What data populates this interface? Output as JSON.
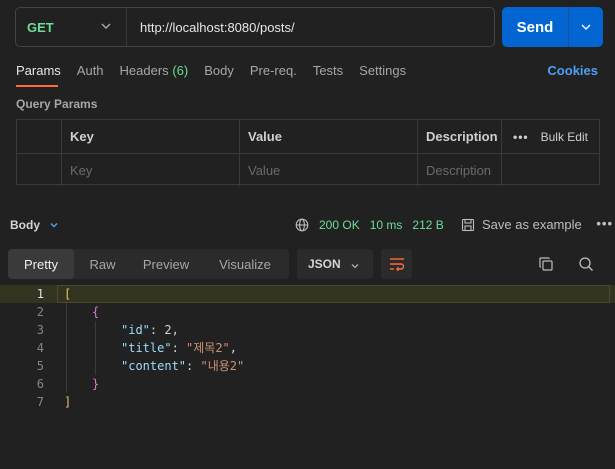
{
  "request": {
    "method": "GET",
    "url": "http://localhost:8080/posts/",
    "send_label": "Send"
  },
  "tabs": [
    {
      "label": "Params"
    },
    {
      "label": "Auth"
    },
    {
      "label": "Headers",
      "count": "(6)"
    },
    {
      "label": "Body"
    },
    {
      "label": "Pre-req."
    },
    {
      "label": "Tests"
    },
    {
      "label": "Settings"
    }
  ],
  "cookies_label": "Cookies",
  "query_params": {
    "title": "Query Params",
    "headers": {
      "key": "Key",
      "value": "Value",
      "description": "Description",
      "bulk_edit": "Bulk Edit",
      "more": "•••"
    },
    "placeholders": {
      "key": "Key",
      "value": "Value",
      "description": "Description"
    }
  },
  "response": {
    "body_label": "Body",
    "status": "200 OK",
    "time": "10 ms",
    "size": "212 B",
    "save_label": "Save as example",
    "more": "•••",
    "view_tabs": [
      "Pretty",
      "Raw",
      "Preview",
      "Visualize"
    ],
    "format": "JSON",
    "lines": [
      {
        "no": "1",
        "text": "["
      },
      {
        "no": "2",
        "text": "{"
      },
      {
        "no": "3",
        "key": "\"id\"",
        "value": "2"
      },
      {
        "no": "4",
        "key": "\"title\"",
        "value": "\"제목2\""
      },
      {
        "no": "5",
        "key": "\"content\"",
        "value": "\"내용2\""
      },
      {
        "no": "6",
        "text": "}"
      },
      {
        "no": "7",
        "text": "]"
      }
    ]
  },
  "colors": {
    "accent": "#0265d2",
    "status_ok": "#6bdd9a",
    "tab_underline": "#ff6c37",
    "link": "#4d9ff2"
  }
}
